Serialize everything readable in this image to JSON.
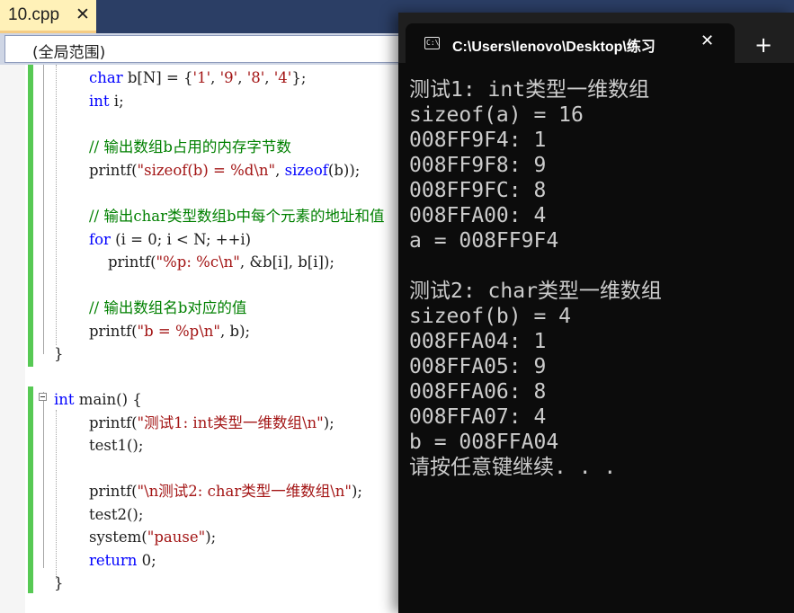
{
  "editor": {
    "tab": {
      "filename": "10.cpp",
      "close": "✕"
    },
    "scope": "(全局范围)",
    "lines": [
      [
        [
          "kw",
          "char"
        ],
        [
          "",
          "b[N] = {"
        ],
        [
          "str",
          "'1'"
        ],
        [
          "",
          ", "
        ],
        [
          "str",
          "'9'"
        ],
        [
          "",
          ", "
        ],
        [
          "str",
          "'8'"
        ],
        [
          "",
          ", "
        ],
        [
          "str",
          "'4'"
        ],
        [
          "",
          "};"
        ]
      ],
      [
        [
          "kw",
          "int"
        ],
        [
          "",
          "i;"
        ]
      ],
      [],
      [
        [
          "cm",
          "// 输出数组b占用的内存字节数"
        ]
      ],
      [
        [
          "",
          "printf("
        ],
        [
          "str",
          "\"sizeof(b) = %d\\n\""
        ],
        [
          "",
          ", "
        ],
        [
          "kw",
          "sizeof"
        ],
        [
          "",
          "(b));"
        ]
      ],
      [],
      [
        [
          "cm",
          "// 输出char类型数组b中每个元素的地址和值"
        ]
      ],
      [
        [
          "kw",
          "for"
        ],
        [
          "",
          " (i = 0; i < N; ++i)"
        ]
      ],
      [
        [
          "",
          "    printf("
        ],
        [
          "str",
          "\"%p: %c\\n\""
        ],
        [
          "",
          ", &b[i], b[i]);"
        ]
      ],
      [],
      [
        [
          "cm",
          "// 输出数组名b对应的值"
        ]
      ],
      [
        [
          "",
          "printf("
        ],
        [
          "str",
          "\"b = %p\\n\""
        ],
        [
          "",
          ", b);"
        ]
      ],
      [
        [
          "",
          "}"
        ]
      ],
      [],
      [
        [
          "kw",
          "int"
        ],
        [
          "",
          " main() {"
        ]
      ],
      [
        [
          "",
          "printf("
        ],
        [
          "str",
          "\"测试1: int类型一维数组\\n\""
        ],
        [
          "",
          ");"
        ]
      ],
      [
        [
          "",
          "test1();"
        ]
      ],
      [],
      [
        [
          "",
          "printf("
        ],
        [
          "str",
          "\"\\n测试2: char类型一维数组\\n\""
        ],
        [
          "",
          ");"
        ]
      ],
      [
        [
          "",
          "test2();"
        ]
      ],
      [
        [
          "",
          "system("
        ],
        [
          "str",
          "\"pause\""
        ],
        [
          "",
          ");"
        ]
      ],
      [
        [
          "kw",
          "return"
        ],
        [
          "",
          " 0;"
        ]
      ],
      [
        [
          "",
          "}"
        ]
      ]
    ]
  },
  "terminal": {
    "title": "C:\\Users\\lenovo\\Desktop\\练习",
    "close": "✕",
    "new_tab": "+",
    "icon_glyph": "C:\\",
    "lines": [
      "测试1: int类型一维数组",
      "sizeof(a) = 16",
      "008FF9F4: 1",
      "008FF9F8: 9",
      "008FF9FC: 8",
      "008FFA00: 4",
      "a = 008FF9F4",
      "",
      "测试2: char类型一维数组",
      "sizeof(b) = 4",
      "008FFA04: 1",
      "008FFA05: 9",
      "008FFA06: 8",
      "008FFA07: 4",
      "b = 008FFA04",
      "请按任意键继续. . ."
    ]
  },
  "colors": {
    "keyword": "#0000ff",
    "string": "#a31515",
    "comment": "#008000",
    "change_bar": "#57c954",
    "vs_tab_bg": "#fff1b8",
    "terminal_bg": "#0c0c0c"
  }
}
